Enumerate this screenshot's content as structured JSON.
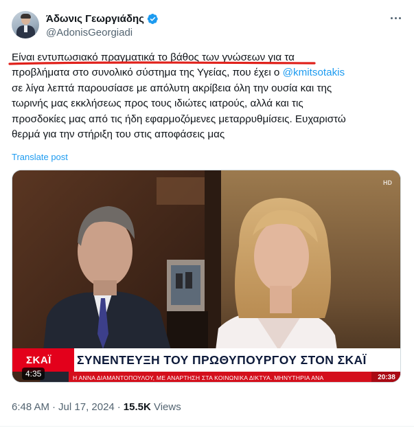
{
  "author": {
    "display_name": "Άδωνις Γεωργιάδης",
    "handle": "@AdonisGeorgiadi",
    "verified_color": "#1d9bf0"
  },
  "tweet": {
    "lines": [
      "Είναι εντυπωσιακό πραγματικά το βάθος των γνώσεων για τα",
      "προβλήματα στο συνολικό σύστημα της Υγείας, που έχει ο",
      "σε λίγα λεπτά παρουσίασε με απόλυτη ακρίβεια όλη την ουσία και της",
      "τωρινής μας εκκλήσεως προς τους ιδιώτες ιατρούς, αλλά και τις",
      "προσδοκίες μας από τις ήδη εφαρμοζόμενες μεταρρυθμίσεις. Ευχαριστώ",
      "θερμά για την στήριξη του στις αποφάσεις μας"
    ],
    "mention": "@kmitsotakis",
    "mention_color": "#1d9bf0",
    "highlight_color": "#e0211b"
  },
  "translate_label": "Translate post",
  "video": {
    "channel": "ΣΚΑΪ",
    "headline": "ΣΥΝΕΝΤΕΥΞΗ ΤΟΥ ΠΡΩΘΥΠΟΥΡΓΟΥ ΣΤΟΝ ΣΚΑΪ",
    "ticker": "Η ΑΝΝΑ ΔΙΑΜΑΝΤΟΠΟΥΛΟΥ, ΜΕ ΑΝΑΡΤΗΣΗ ΣΤΑ ΚΟΙΝΩΝΙΚΑ ΔΙΚΤΥΑ.   ΜΗΝΥΤΗΡΙΑ ΑΝΑ",
    "clock": "20:38",
    "hd": "HD",
    "duration": "4:35"
  },
  "meta": {
    "time": "6:48 AM",
    "date": "Jul 17, 2024",
    "views_count": "15.5K",
    "views_label": "Views"
  }
}
